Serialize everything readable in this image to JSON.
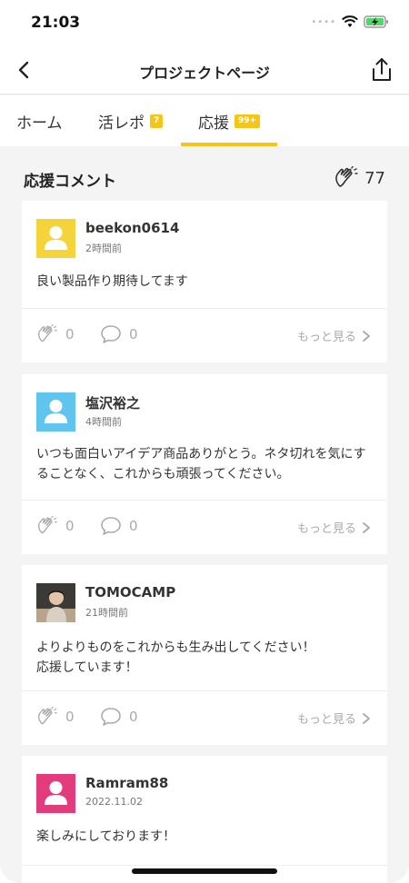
{
  "status_bar": {
    "time": "21:03",
    "signal_icon": "signal-dots-icon",
    "wifi_icon": "wifi-icon",
    "battery_icon": "battery-charging-icon"
  },
  "nav": {
    "title": "プロジェクトページ",
    "back_icon": "chevron-left-icon",
    "share_icon": "share-icon"
  },
  "tabs": [
    {
      "label": "ホーム",
      "badge": ""
    },
    {
      "label": "活レポ",
      "badge": "7"
    },
    {
      "label": "応援",
      "badge": "99+",
      "active": true
    }
  ],
  "section": {
    "title": "応援コメント",
    "clap_count": "77",
    "clap_icon": "clap-icon"
  },
  "comments": [
    {
      "user": "beekon0614",
      "time": "2時間前",
      "text": "良い製品作り期待してます",
      "claps": "0",
      "replies": "0",
      "more": "もっと見る",
      "avatar_color": "#f5d33a"
    },
    {
      "user": "塩沢裕之",
      "time": "4時間前",
      "text": "いつも面白いアイデア商品ありがとう。ネタ切れを気にすることなく、これからも頑張ってください。",
      "claps": "0",
      "replies": "0",
      "more": "もっと見る",
      "avatar_color": "#5fc4ee"
    },
    {
      "user": "TOMOCAMP",
      "time": "21時間前",
      "text": "よりよりものをこれからも生み出してください！\n応援しています！",
      "claps": "0",
      "replies": "0",
      "more": "もっと見る",
      "avatar_color": "#8a7a6a"
    },
    {
      "user": "Ramram88",
      "time": "2022.11.02",
      "text": "楽しみにしております！",
      "claps": "",
      "replies": "",
      "more": "",
      "avatar_color": "#e33c7c"
    }
  ],
  "colors": {
    "accent": "#f5c518",
    "background": "#f4f4f4"
  }
}
